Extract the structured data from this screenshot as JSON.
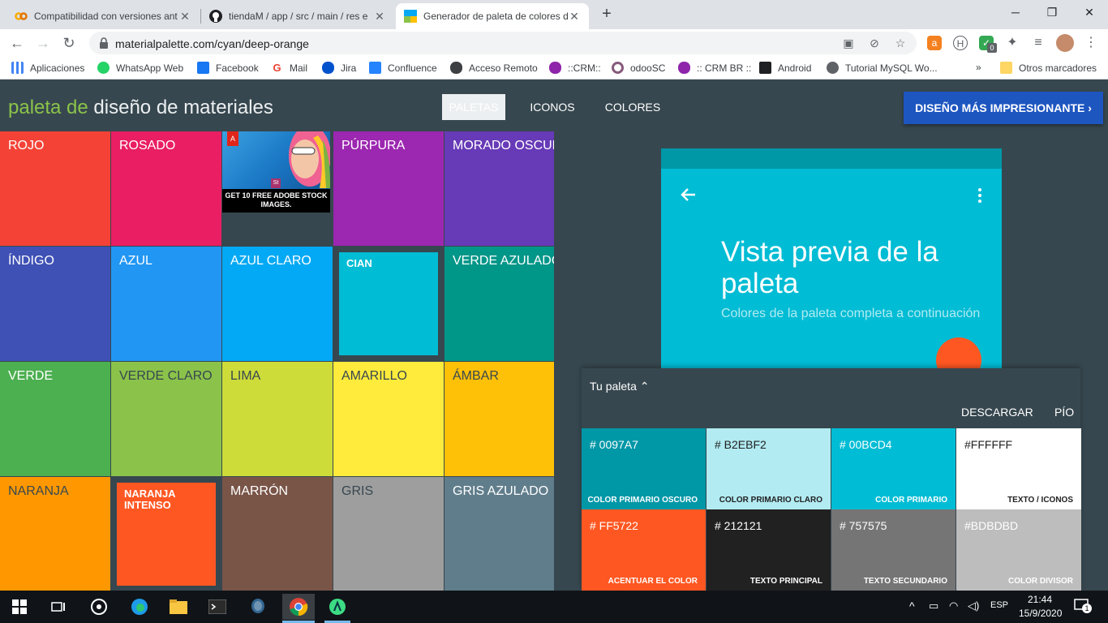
{
  "browser": {
    "tabs": [
      {
        "title": "Compatibilidad con versiones ant",
        "icon": "colab-icon"
      },
      {
        "title": "tiendaM / app / src / main / res e",
        "icon": "github-icon"
      },
      {
        "title": "Generador de paleta de colores d",
        "icon": "material-palette-icon"
      }
    ],
    "new_tab": "+",
    "window_controls": {
      "minimize": "─",
      "maximize": "❐",
      "close": "✕"
    },
    "url": "materialpalette.com/cyan/deep-orange",
    "extension_badge": "0",
    "bookmarks": [
      {
        "label": "Aplicaciones",
        "color": "#4285f4"
      },
      {
        "label": "WhatsApp Web",
        "color": "#25d366"
      },
      {
        "label": "Facebook",
        "color": "#1877f2"
      },
      {
        "label": "Mail",
        "color": "#ea4335"
      },
      {
        "label": "Jira",
        "color": "#0052cc"
      },
      {
        "label": "Confluence",
        "color": "#2684ff"
      },
      {
        "label": "Acceso Remoto",
        "color": "#5f6368"
      },
      {
        "label": "::CRM::",
        "color": "#8e24aa"
      },
      {
        "label": "odooSC",
        "color": "#875a7b"
      },
      {
        "label": ":: CRM BR ::",
        "color": "#8e24aa"
      },
      {
        "label": "Android",
        "color": "#202124"
      },
      {
        "label": "Tutorial MySQL Wo...",
        "color": "#5f6368"
      }
    ],
    "bookmarks_overflow": "»",
    "other_bookmarks": "Otros marcadores"
  },
  "app": {
    "logo_accent": "paleta de",
    "logo_rest": " diseño de materiales",
    "nav": [
      "PALETAS",
      "ICONOS",
      "COLORES"
    ],
    "cta": "DISEÑO MÁS IMPRESIONANTE",
    "cta_chevron": "›"
  },
  "colors": [
    {
      "name": "ROJO",
      "hex": "#f44336",
      "text": "#ffffff"
    },
    {
      "name": "ROSADO",
      "hex": "#e91e63",
      "text": "#ffffff"
    },
    {
      "name": "",
      "hex": "#37474f",
      "text": "#ffffff",
      "ad": true
    },
    {
      "name": "PÚRPURA",
      "hex": "#9c27b0",
      "text": "#ffffff"
    },
    {
      "name": "MORADO OSCURO",
      "hex": "#673ab7",
      "text": "#ffffff"
    },
    {
      "name": "ÍNDIGO",
      "hex": "#3f51b5",
      "text": "#ffffff"
    },
    {
      "name": "AZUL",
      "hex": "#2196f3",
      "text": "#ffffff"
    },
    {
      "name": "AZUL CLARO",
      "hex": "#03a9f4",
      "text": "#ffffff"
    },
    {
      "name": "CIAN",
      "hex": "#00bcd4",
      "text": "#ffffff",
      "selected": true
    },
    {
      "name": "VERDE AZULADO",
      "hex": "#009688",
      "text": "#ffffff"
    },
    {
      "name": "VERDE",
      "hex": "#4caf50",
      "text": "#ffffff"
    },
    {
      "name": "VERDE CLARO",
      "hex": "#8bc34a",
      "text": "#37474f"
    },
    {
      "name": "LIMA",
      "hex": "#cddc39",
      "text": "#37474f"
    },
    {
      "name": "AMARILLO",
      "hex": "#ffeb3b",
      "text": "#37474f"
    },
    {
      "name": "ÁMBAR",
      "hex": "#ffc107",
      "text": "#37474f"
    },
    {
      "name": "NARANJA",
      "hex": "#ff9800",
      "text": "#37474f"
    },
    {
      "name": "NARANJA INTENSO",
      "hex": "#ff5722",
      "text": "#ffffff",
      "selected": true
    },
    {
      "name": "MARRÓN",
      "hex": "#795548",
      "text": "#ffffff"
    },
    {
      "name": "GRIS",
      "hex": "#9e9e9e",
      "text": "#37474f"
    },
    {
      "name": "GRIS AZULADO",
      "hex": "#607d8b",
      "text": "#ffffff"
    }
  ],
  "ad": {
    "brand": "A",
    "stock_badge": "St",
    "text": "GET 10 FREE ADOBE STOCK IMAGES."
  },
  "preview": {
    "title": "Vista previa de la paleta",
    "subtitle": "Colores de la paleta completa a continuación"
  },
  "palette": {
    "title": "Tu paleta",
    "title_chevron": "⌃",
    "download": "DESCARGAR",
    "tweet": "PÍO",
    "swatches": [
      {
        "hex": "# 0097A7",
        "role": "COLOR PRIMARIO OSCURO",
        "bg": "#0097a7",
        "fg": "#ffffff"
      },
      {
        "hex": "# B2EBF2",
        "role": "COLOR PRIMARIO CLARO",
        "bg": "#b2ebf2",
        "fg": "#212121"
      },
      {
        "hex": "# 00BCD4",
        "role": "COLOR PRIMARIO",
        "bg": "#00bcd4",
        "fg": "#ffffff"
      },
      {
        "hex": "#FFFFFF",
        "role": "TEXTO / ICONOS",
        "bg": "#ffffff",
        "fg": "#212121"
      },
      {
        "hex": "# FF5722",
        "role": "ACENTUAR EL COLOR",
        "bg": "#ff5722",
        "fg": "#ffffff"
      },
      {
        "hex": "# 212121",
        "role": "TEXTO PRINCIPAL",
        "bg": "#212121",
        "fg": "#ffffff"
      },
      {
        "hex": "# 757575",
        "role": "TEXTO SECUNDARIO",
        "bg": "#757575",
        "fg": "#ffffff"
      },
      {
        "hex": "#BDBDBD",
        "role": "COLOR DIVISOR",
        "bg": "#bdbdbd",
        "fg": "#ffffff"
      }
    ]
  },
  "taskbar": {
    "apps": [
      "start-icon",
      "task-view-icon",
      "cortana-icon",
      "edge-icon",
      "file-explorer-icon",
      "terminal-icon",
      "postgres-icon",
      "chrome-icon",
      "android-studio-icon"
    ],
    "language": "ESP",
    "time": "21:44",
    "date": "15/9/2020",
    "notifications": "1"
  }
}
